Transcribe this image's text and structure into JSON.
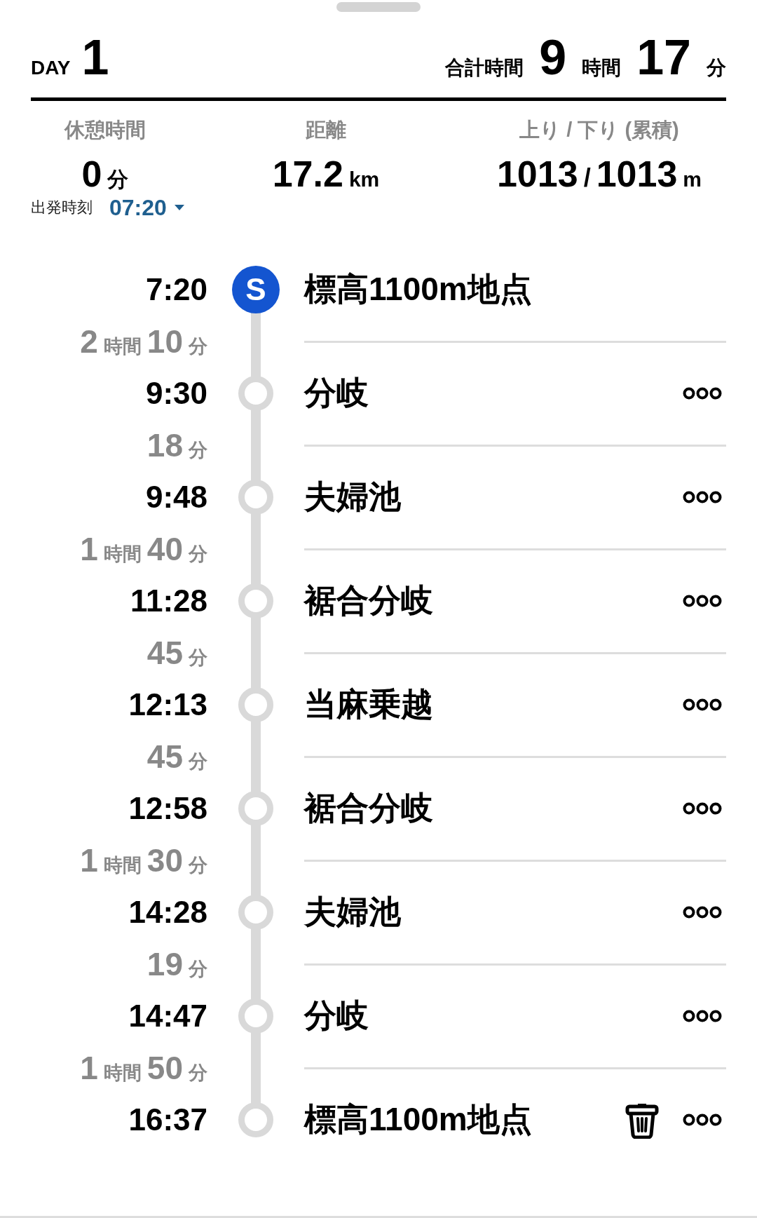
{
  "header": {
    "day_label": "DAY",
    "day": "1",
    "total_label": "合計時間",
    "total_hours": "9",
    "hours_unit": "時間",
    "total_minutes": "17",
    "minutes_unit": "分"
  },
  "stats": [
    {
      "label": "休憩時間",
      "value": "0",
      "unit": "分"
    },
    {
      "label": "距離",
      "value": "17.2",
      "unit": "km"
    },
    {
      "label": "上り / 下り (累積)",
      "value": "1013",
      "sep": "/",
      "value2": "1013",
      "unit": "m"
    }
  ],
  "departure": {
    "label": "出発時刻",
    "value": "07:20"
  },
  "stops": [
    {
      "kind": "start",
      "badge": "S",
      "time": "7:20",
      "name": "標高1100m地点",
      "menu": false,
      "deletable": false
    },
    {
      "kind": "waypoint",
      "time": "9:30",
      "name": "分岐",
      "menu": true,
      "deletable": false,
      "leg": {
        "hours": "2",
        "hours_unit": "時間",
        "minutes": "10",
        "minutes_unit": "分"
      }
    },
    {
      "kind": "waypoint",
      "time": "9:48",
      "name": "夫婦池",
      "menu": true,
      "deletable": false,
      "leg": {
        "minutes": "18",
        "minutes_unit": "分"
      }
    },
    {
      "kind": "waypoint",
      "time": "11:28",
      "name": "裾合分岐",
      "menu": true,
      "deletable": false,
      "leg": {
        "hours": "1",
        "hours_unit": "時間",
        "minutes": "40",
        "minutes_unit": "分"
      }
    },
    {
      "kind": "waypoint",
      "time": "12:13",
      "name": "当麻乗越",
      "menu": true,
      "deletable": false,
      "leg": {
        "minutes": "45",
        "minutes_unit": "分"
      }
    },
    {
      "kind": "waypoint",
      "time": "12:58",
      "name": "裾合分岐",
      "menu": true,
      "deletable": false,
      "leg": {
        "minutes": "45",
        "minutes_unit": "分"
      }
    },
    {
      "kind": "waypoint",
      "time": "14:28",
      "name": "夫婦池",
      "menu": true,
      "deletable": false,
      "leg": {
        "hours": "1",
        "hours_unit": "時間",
        "minutes": "30",
        "minutes_unit": "分"
      }
    },
    {
      "kind": "waypoint",
      "time": "14:47",
      "name": "分岐",
      "menu": true,
      "deletable": false,
      "leg": {
        "minutes": "19",
        "minutes_unit": "分"
      }
    },
    {
      "kind": "waypoint",
      "time": "16:37",
      "name": "標高1100m地点",
      "menu": true,
      "deletable": true,
      "leg": {
        "hours": "1",
        "hours_unit": "時間",
        "minutes": "50",
        "minutes_unit": "分"
      }
    }
  ]
}
